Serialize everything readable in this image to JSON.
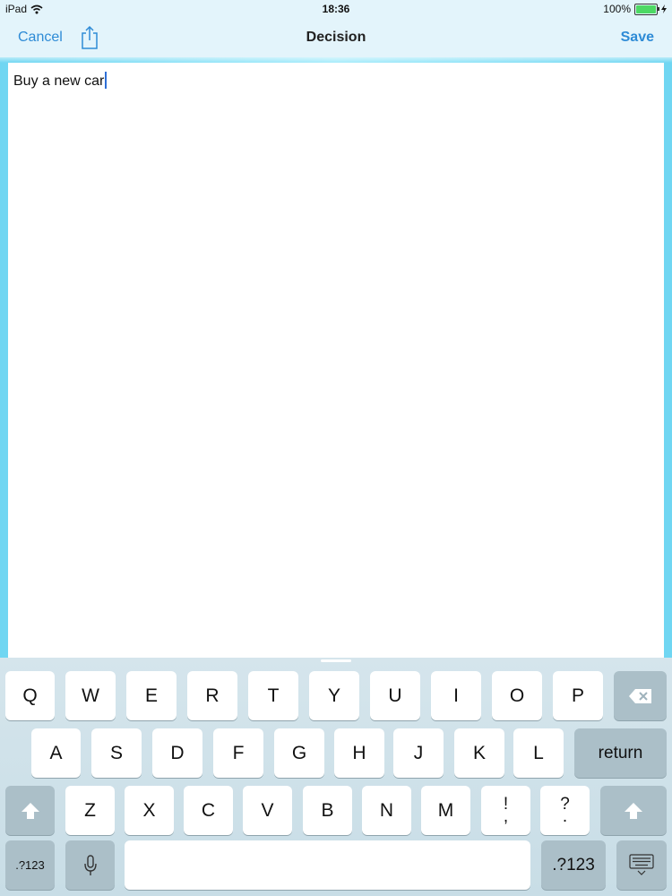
{
  "status_bar": {
    "device": "iPad",
    "time": "18:36",
    "battery": "100%"
  },
  "nav": {
    "cancel_label": "Cancel",
    "title": "Decision",
    "save_label": "Save",
    "share_icon": "share-icon"
  },
  "editor": {
    "text": "Buy a new car"
  },
  "keyboard": {
    "row1": [
      "Q",
      "W",
      "E",
      "R",
      "T",
      "Y",
      "U",
      "I",
      "O",
      "P"
    ],
    "row2": [
      "A",
      "S",
      "D",
      "F",
      "G",
      "H",
      "J",
      "K",
      "L"
    ],
    "row3": [
      "Z",
      "X",
      "C",
      "V",
      "B",
      "N",
      "M"
    ],
    "punct1_top": "!",
    "punct1_bottom": ",",
    "punct2_top": "?",
    "punct2_bottom": ".",
    "return_label": "return",
    "numbers_left_label": ".?123",
    "numbers_right_label": ".?123",
    "delete_icon": "delete-icon",
    "shift_icon": "shift-icon",
    "mic_icon": "microphone-icon",
    "hide_keyboard_icon": "hide-keyboard-icon"
  },
  "colors": {
    "accent": "#2e8bd6",
    "frame": "#6fd6f2",
    "keyboard_bg": "#d0e2e9"
  }
}
